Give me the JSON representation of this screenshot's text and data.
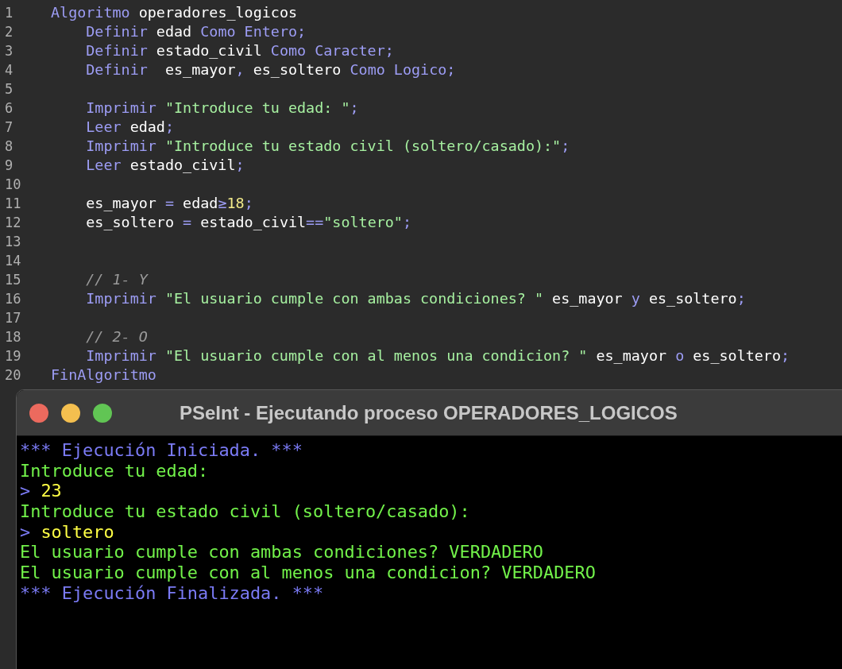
{
  "editor": {
    "lines": [
      {
        "number": "1",
        "tokens": [
          {
            "kind": "keyword",
            "text": "Algoritmo"
          },
          {
            "kind": "ident",
            "text": " operadores_logicos"
          }
        ]
      },
      {
        "number": "2",
        "tokens": [
          {
            "kind": "keyword",
            "text": "    Definir"
          },
          {
            "kind": "ident",
            "text": " edad "
          },
          {
            "kind": "keyword",
            "text": "Como Entero;"
          }
        ]
      },
      {
        "number": "3",
        "tokens": [
          {
            "kind": "keyword",
            "text": "    Definir"
          },
          {
            "kind": "ident",
            "text": " estado_civil "
          },
          {
            "kind": "keyword",
            "text": "Como Caracter;"
          }
        ]
      },
      {
        "number": "4",
        "tokens": [
          {
            "kind": "keyword",
            "text": "    Definir"
          },
          {
            "kind": "ident",
            "text": "  es_mayor"
          },
          {
            "kind": "keyword",
            "text": ","
          },
          {
            "kind": "ident",
            "text": " es_soltero "
          },
          {
            "kind": "keyword",
            "text": "Como Logico;"
          }
        ]
      },
      {
        "number": "5"
      },
      {
        "number": "6",
        "tokens": [
          {
            "kind": "keyword",
            "text": "    Imprimir "
          },
          {
            "kind": "string",
            "text": "\"Introduce tu edad: \""
          },
          {
            "kind": "keyword",
            "text": ";"
          }
        ]
      },
      {
        "number": "7",
        "tokens": [
          {
            "kind": "keyword",
            "text": "    Leer"
          },
          {
            "kind": "ident",
            "text": " edad"
          },
          {
            "kind": "keyword",
            "text": ";"
          }
        ]
      },
      {
        "number": "8",
        "tokens": [
          {
            "kind": "keyword",
            "text": "    Imprimir "
          },
          {
            "kind": "string",
            "text": "\"Introduce tu estado civil (soltero/casado):\""
          },
          {
            "kind": "keyword",
            "text": ";"
          }
        ]
      },
      {
        "number": "9",
        "tokens": [
          {
            "kind": "keyword",
            "text": "    Leer"
          },
          {
            "kind": "ident",
            "text": " estado_civil"
          },
          {
            "kind": "keyword",
            "text": ";"
          }
        ]
      },
      {
        "number": "10"
      },
      {
        "number": "11",
        "tokens": [
          {
            "kind": "ident",
            "text": "    es_mayor "
          },
          {
            "kind": "keyword",
            "text": "="
          },
          {
            "kind": "ident",
            "text": " edad"
          },
          {
            "kind": "keyword",
            "text": "≥"
          },
          {
            "kind": "number",
            "text": "18"
          },
          {
            "kind": "keyword",
            "text": ";"
          }
        ]
      },
      {
        "number": "12",
        "tokens": [
          {
            "kind": "ident",
            "text": "    es_soltero "
          },
          {
            "kind": "keyword",
            "text": "="
          },
          {
            "kind": "ident",
            "text": " estado_civil"
          },
          {
            "kind": "keyword",
            "text": "=="
          },
          {
            "kind": "string",
            "text": "\"soltero\""
          },
          {
            "kind": "keyword",
            "text": ";"
          }
        ]
      },
      {
        "number": "13"
      },
      {
        "number": "14"
      },
      {
        "number": "15",
        "tokens": [
          {
            "kind": "comment",
            "text": "    // 1- Y"
          }
        ]
      },
      {
        "number": "16",
        "tokens": [
          {
            "kind": "keyword",
            "text": "    Imprimir "
          },
          {
            "kind": "string",
            "text": "\"El usuario cumple con ambas condiciones? \""
          },
          {
            "kind": "ident",
            "text": " es_mayor "
          },
          {
            "kind": "keyword",
            "text": "y"
          },
          {
            "kind": "ident",
            "text": " es_soltero"
          },
          {
            "kind": "keyword",
            "text": ";"
          }
        ]
      },
      {
        "number": "17"
      },
      {
        "number": "18",
        "tokens": [
          {
            "kind": "comment",
            "text": "    // 2- O"
          }
        ]
      },
      {
        "number": "19",
        "tokens": [
          {
            "kind": "keyword",
            "text": "    Imprimir "
          },
          {
            "kind": "string",
            "text": "\"El usuario cumple con al menos una condicion? \""
          },
          {
            "kind": "ident",
            "text": " es_mayor "
          },
          {
            "kind": "keyword",
            "text": "o"
          },
          {
            "kind": "ident",
            "text": " es_soltero"
          },
          {
            "kind": "keyword",
            "text": ";"
          }
        ]
      },
      {
        "number": "20",
        "tokens": [
          {
            "kind": "keyword",
            "text": "FinAlgoritmo"
          }
        ]
      }
    ]
  },
  "console": {
    "title": "PSeInt - Ejecutando proceso OPERADORES_LOGICOS",
    "lines": [
      {
        "kind": "banner",
        "text": "*** Ejecución Iniciada. ***"
      },
      {
        "kind": "output",
        "text": "Introduce tu edad:"
      },
      {
        "kind": "input",
        "prompt": ">",
        "text": "23"
      },
      {
        "kind": "output",
        "text": "Introduce tu estado civil (soltero/casado):"
      },
      {
        "kind": "input",
        "prompt": ">",
        "text": "soltero"
      },
      {
        "kind": "output",
        "text": "El usuario cumple con ambas condiciones? VERDADERO"
      },
      {
        "kind": "output",
        "text": "El usuario cumple con al menos una condicion? VERDADERO"
      },
      {
        "kind": "banner",
        "text": "*** Ejecución Finalizada. ***"
      }
    ]
  }
}
